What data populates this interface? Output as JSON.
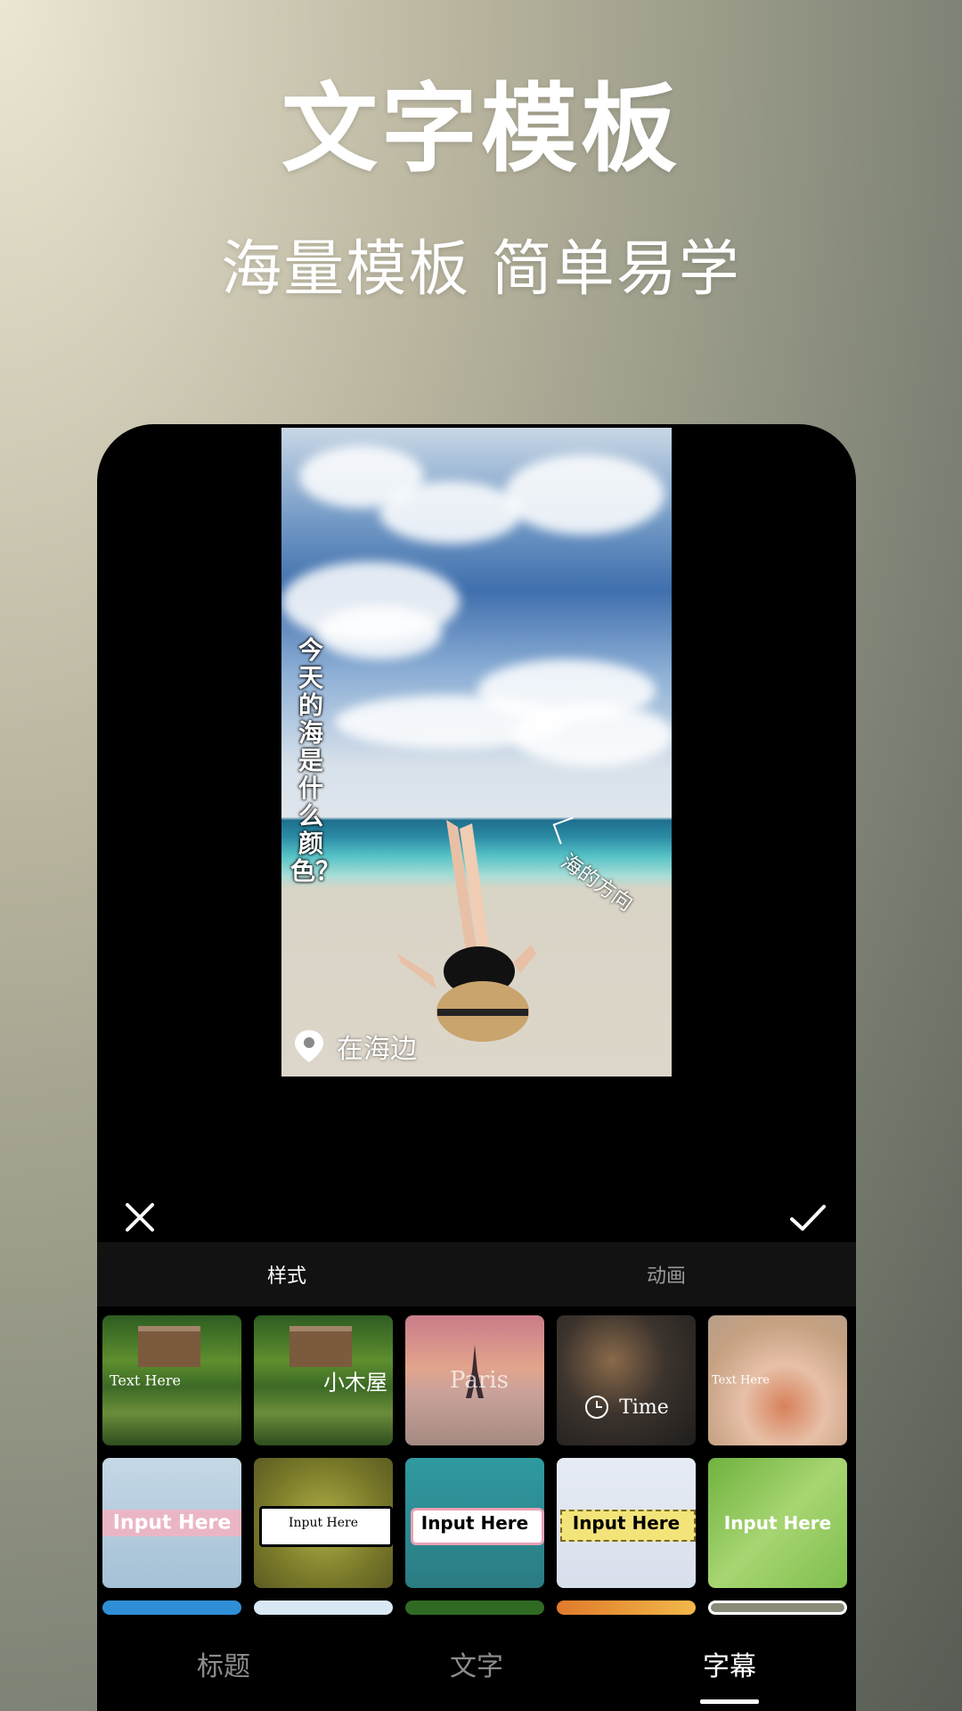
{
  "promo": {
    "title": "文字模板",
    "subtitle": "海量模板 简单易学"
  },
  "preview": {
    "vertical_caption": "今天的海是什么颜色？",
    "diagonal_caption": "海的方向",
    "location_label": "在海边"
  },
  "editor": {
    "segment_tabs": [
      "样式",
      "动画"
    ],
    "active_segment": 0
  },
  "templates": [
    {
      "label": "Text Here"
    },
    {
      "label": "小木屋"
    },
    {
      "label": "Paris"
    },
    {
      "label": "Time"
    },
    {
      "label": "Text Here"
    },
    {
      "label": "Input Here"
    },
    {
      "label": "Input Here"
    },
    {
      "label": "Input Here"
    },
    {
      "label": "Input Here"
    },
    {
      "label": "Input Here"
    }
  ],
  "bottom_nav": {
    "tabs": [
      "标题",
      "文字",
      "字幕"
    ],
    "active": 2
  },
  "colors": {
    "accent": "#ffffff",
    "panel": "#121212",
    "inactive_text": "#8d8d8d"
  }
}
